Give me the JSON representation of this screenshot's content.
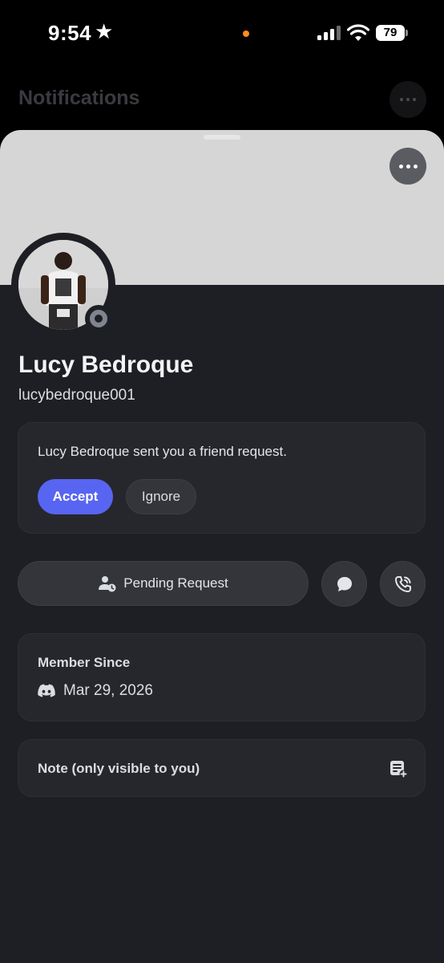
{
  "status_bar": {
    "time": "9:54",
    "battery": "79"
  },
  "background": {
    "title": "Notifications"
  },
  "profile": {
    "display_name": "Lucy Bedroque",
    "username": "lucybedroque001"
  },
  "friend_request": {
    "message": "Lucy Bedroque sent you a friend request.",
    "accept_label": "Accept",
    "ignore_label": "Ignore"
  },
  "actions": {
    "pending_label": "Pending Request"
  },
  "member_since": {
    "title": "Member Since",
    "date": "Mar 29, 2026"
  },
  "note": {
    "label": "Note (only visible to you)"
  },
  "colors": {
    "accent": "#5865f2",
    "sheet": "#1e1f24",
    "card": "#26272d",
    "banner": "#d6d6d6",
    "offline": "#80848e"
  },
  "icons": [
    "star-icon",
    "signal-icon",
    "wifi-icon",
    "battery-icon",
    "more-icon",
    "pending-user-icon",
    "message-icon",
    "call-icon",
    "discord-icon",
    "note-add-icon"
  ]
}
